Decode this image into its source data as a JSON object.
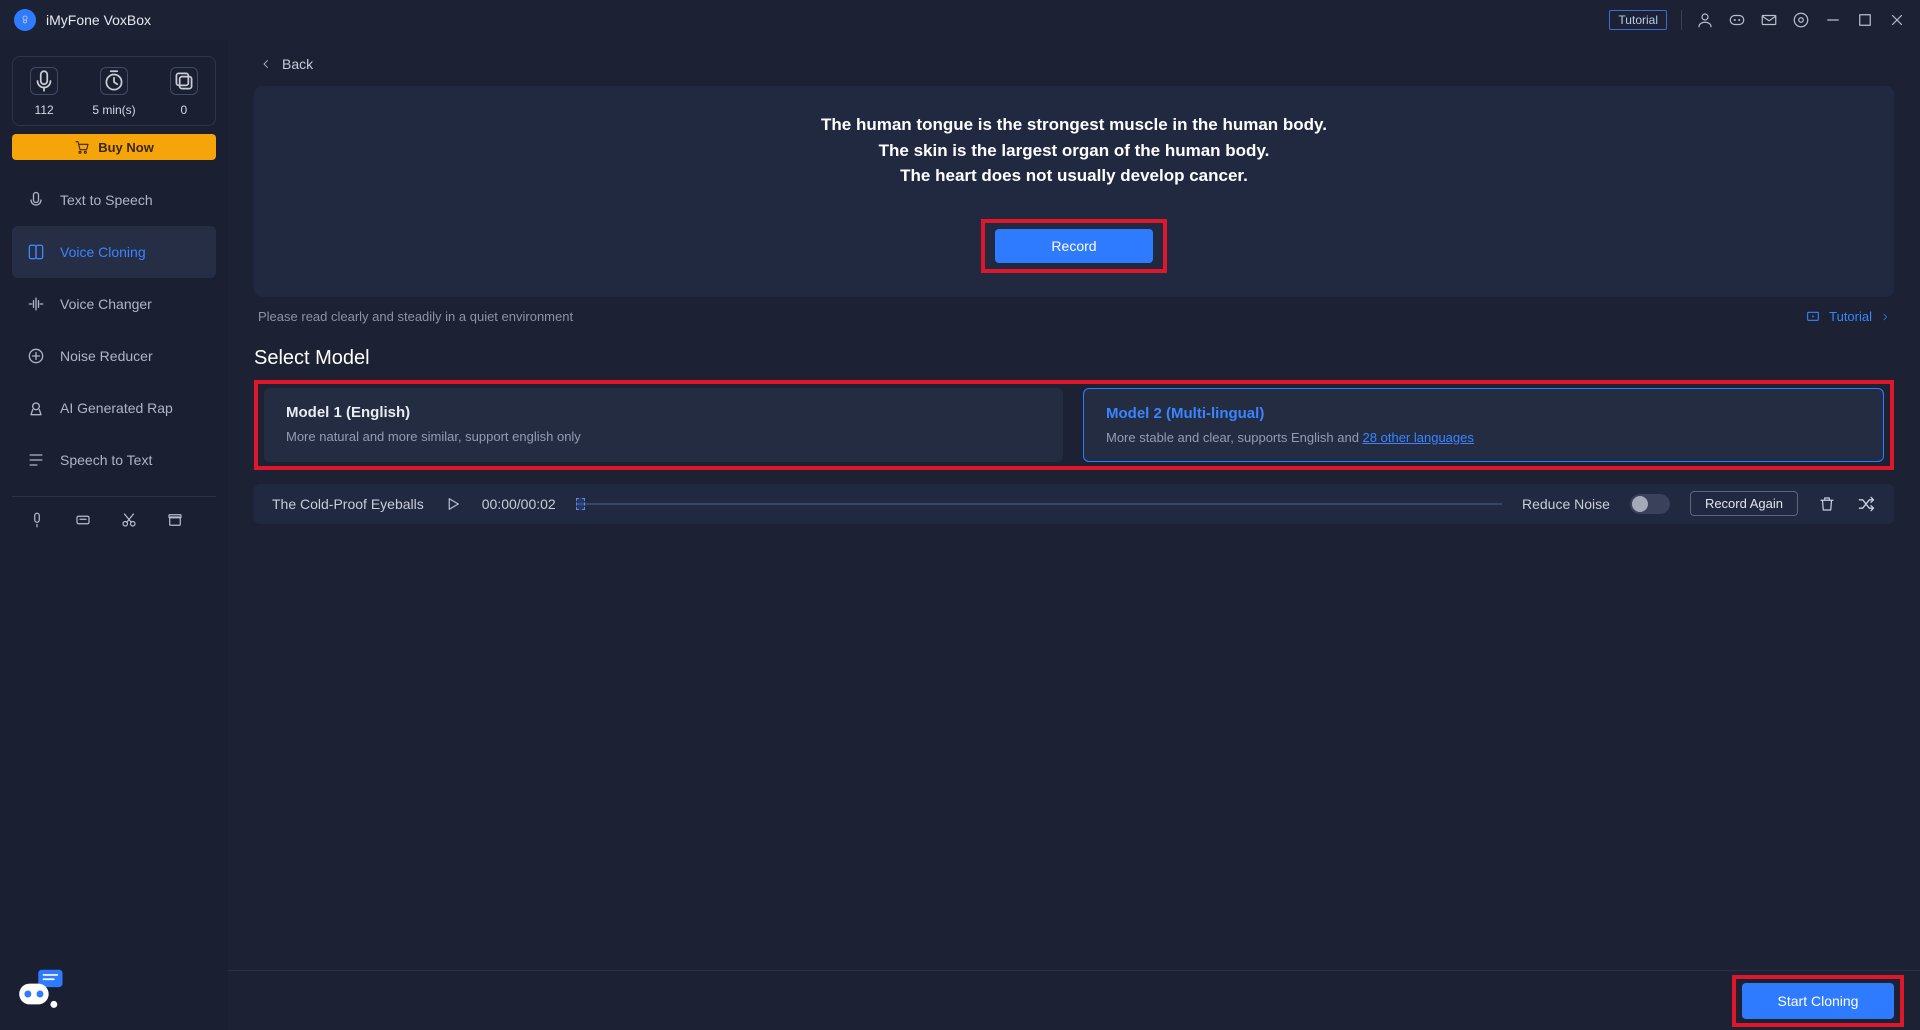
{
  "app": {
    "title": "iMyFone VoxBox"
  },
  "titlebar": {
    "tutorial": "Tutorial"
  },
  "sidebar": {
    "stats": {
      "v0": "112",
      "v1": "5 min(s)",
      "v2": "0"
    },
    "buy_now": "Buy Now",
    "items": [
      {
        "label": "Text to Speech"
      },
      {
        "label": "Voice Cloning"
      },
      {
        "label": "Voice Changer"
      },
      {
        "label": "Noise Reducer"
      },
      {
        "label": "AI Generated Rap"
      },
      {
        "label": "Speech to Text"
      }
    ]
  },
  "main": {
    "back": "Back",
    "read_text": {
      "l1": "The human tongue is the strongest muscle in the human body.",
      "l2": "The skin is the largest organ of the human body.",
      "l3": "The heart does not usually develop cancer."
    },
    "record": "Record",
    "hint": "Please read clearly and steadily in a quiet environment",
    "tutorial": "Tutorial",
    "select_model": "Select Model",
    "models": [
      {
        "title": "Model 1 (English)",
        "desc": "More natural and more similar, support english only"
      },
      {
        "title": "Model 2 (Multi-lingual)",
        "desc_prefix": "More stable and clear, supports English and ",
        "desc_link": "28 other languages"
      }
    ],
    "player": {
      "name": "The Cold-Proof Eyeballs",
      "time": "00:00/00:02",
      "reduce": "Reduce Noise",
      "again": "Record Again"
    },
    "start": "Start Cloning"
  }
}
